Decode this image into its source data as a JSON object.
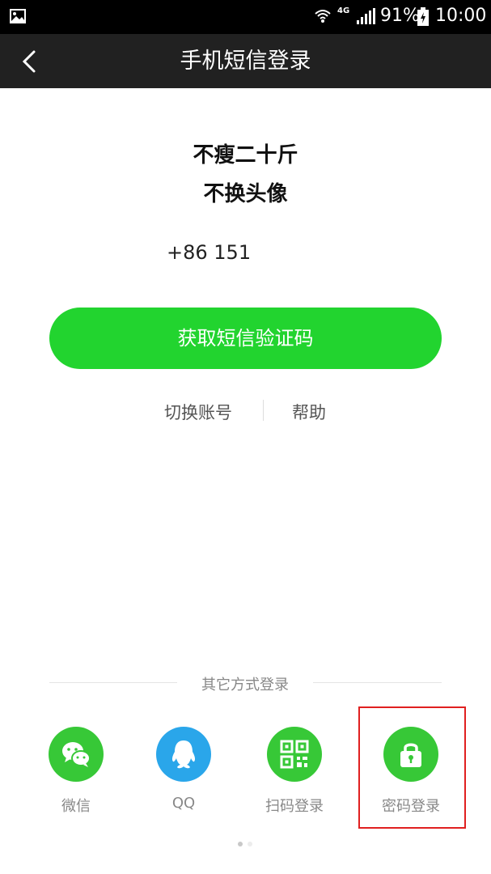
{
  "status_bar": {
    "network": "4G",
    "battery": "91%",
    "time": "10:00",
    "icons": [
      "image-icon",
      "wifi-icon",
      "signal-icon",
      "battery-icon"
    ]
  },
  "header": {
    "title": "手机短信登录",
    "back_icon": "chevron-left-icon"
  },
  "slogan": {
    "line1": "不瘦二十斤",
    "line2": "不换头像"
  },
  "phone_number": "+86 151",
  "sms_button_label": "获取短信验证码",
  "links": {
    "switch_account": "切换账号",
    "help": "帮助"
  },
  "other_login": {
    "title": "其它方式登录",
    "options": [
      {
        "label": "微信",
        "icon": "wechat-icon"
      },
      {
        "label": "QQ",
        "icon": "qq-icon"
      },
      {
        "label": "扫码登录",
        "icon": "qrcode-icon"
      },
      {
        "label": "密码登录",
        "icon": "lock-icon"
      }
    ]
  },
  "colors": {
    "accent_green": "#22d42f",
    "title_bar": "#212121",
    "qq_blue": "#2aa6ea",
    "highlight": "#e02020"
  }
}
